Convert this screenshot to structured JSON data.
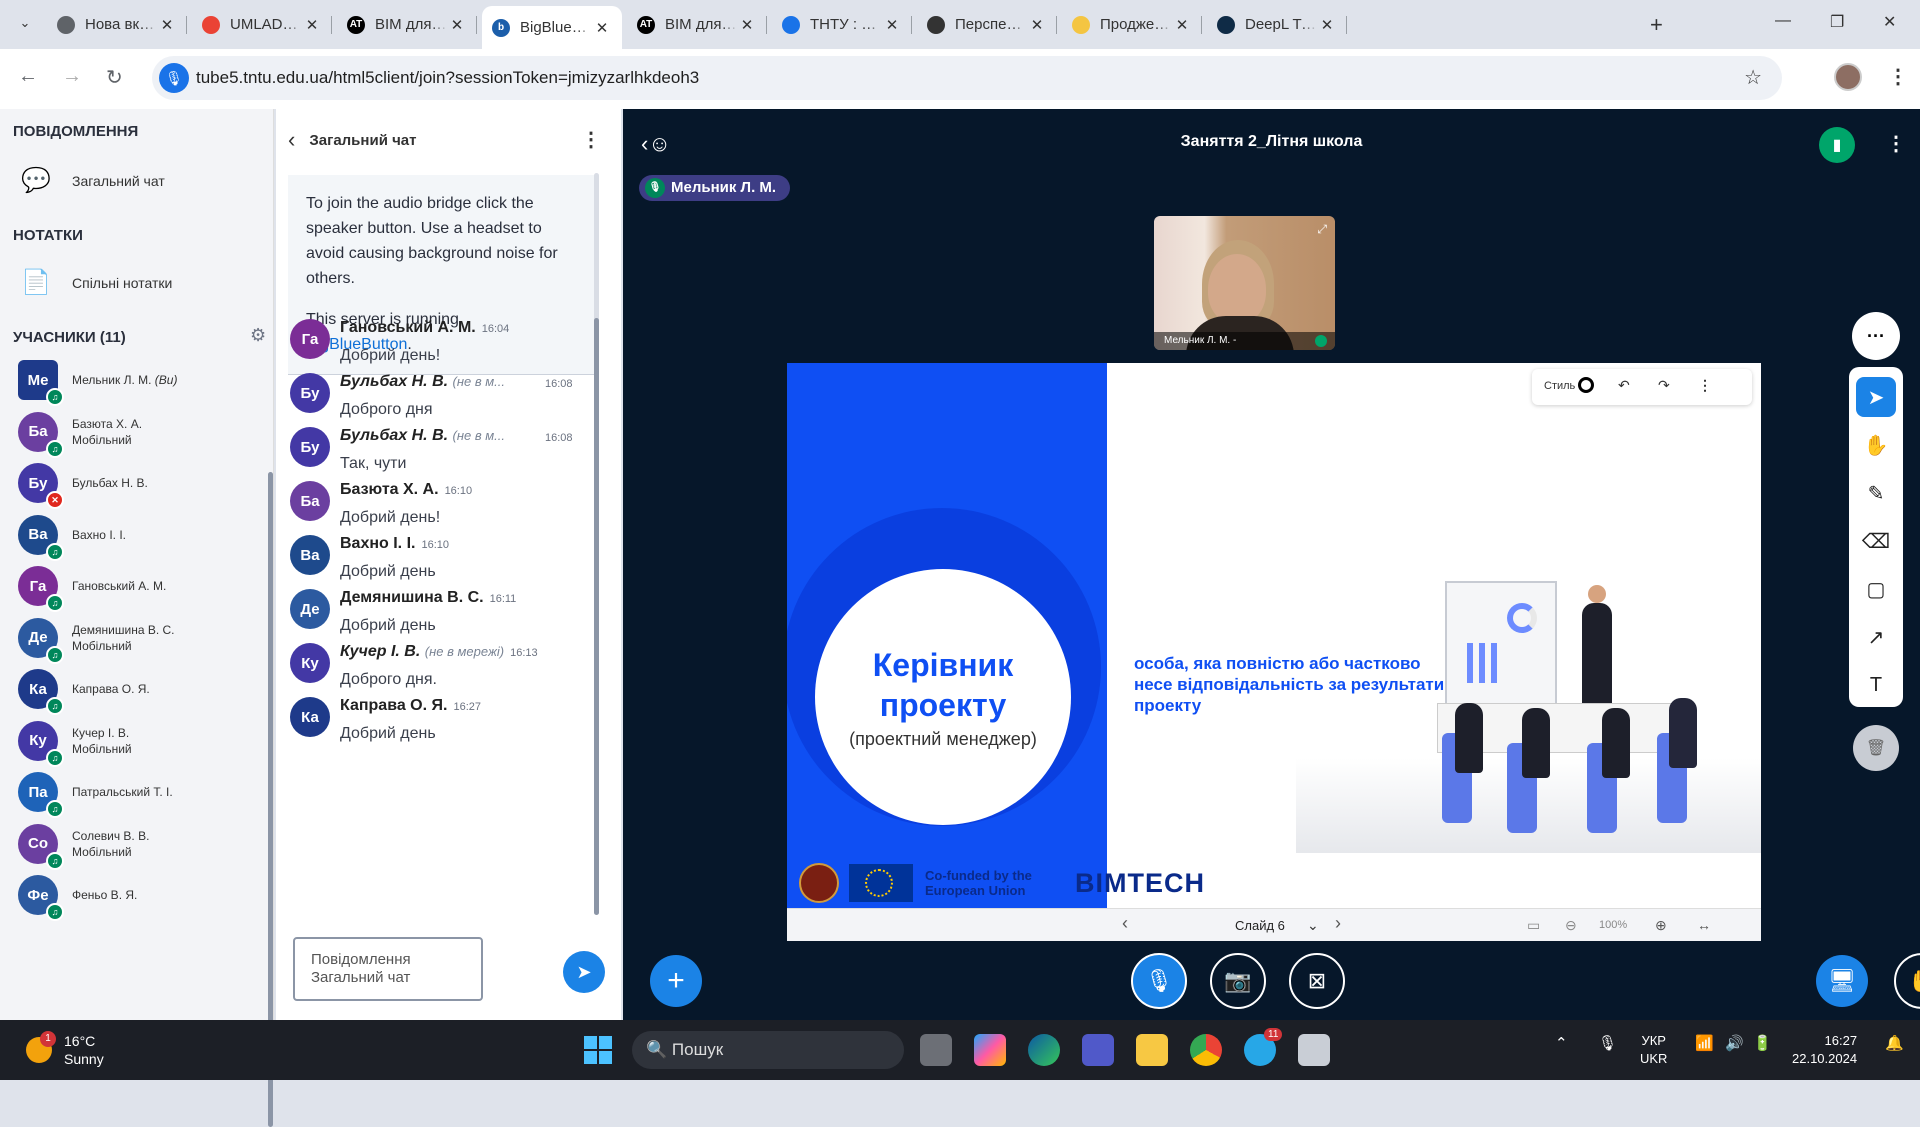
{
  "browser": {
    "tabs": [
      {
        "title": "Нова вкладка",
        "fav": "chrome",
        "color": "#5f6368"
      },
      {
        "title": "UMLADUNG",
        "fav": "gmail",
        "color": "#ea4335"
      },
      {
        "title": "BIM для реконструкції",
        "fav": "AT",
        "color": "#000000"
      },
      {
        "title": "BigBlueButton",
        "fav": "b",
        "color": "#1b5eaa",
        "active": true
      },
      {
        "title": "BIM для реконструкції",
        "fav": "AT",
        "color": "#000000"
      },
      {
        "title": "ТНТУ : Розклад",
        "fav": "tntu",
        "color": "#1a73e8"
      },
      {
        "title": "Перспективи",
        "fav": "gpt",
        "color": "#333333"
      },
      {
        "title": "Проджект менеджмент",
        "fav": "python",
        "color": "#f4c542"
      },
      {
        "title": "DeepL Translate",
        "fav": "deepl",
        "color": "#0f2b46"
      }
    ],
    "url": "tube5.tntu.edu.ua/html5client/join?sessionToken=jmizyzarlhkdeoh3"
  },
  "sidebar": {
    "messages_heading": "ПОВІДОМЛЕННЯ",
    "public_chat": "Загальний чат",
    "notes_heading": "НОТАТКИ",
    "shared_notes": "Спільні нотатки",
    "participants_heading": "УЧАСНИКИ (11)",
    "users": [
      {
        "initials": "Ме",
        "name": "Мельник Л. М.",
        "suffix": "(Ви)",
        "sub": "",
        "color": "#1e3a8a",
        "status": "mic",
        "presenter": true
      },
      {
        "initials": "Ба",
        "name": "Базюта Х. А.",
        "sub": "Мобільний",
        "color": "#6b3fa0",
        "status": "listen"
      },
      {
        "initials": "Бу",
        "name": "Бульбах Н. В.",
        "sub": "",
        "color": "#4338a5",
        "status": "muted"
      },
      {
        "initials": "Ва",
        "name": "Вахно І. І.",
        "sub": "",
        "color": "#1e4a8c",
        "status": "listen"
      },
      {
        "initials": "Га",
        "name": "Гановський А. М.",
        "sub": "",
        "color": "#7b2d96",
        "status": "listen"
      },
      {
        "initials": "Де",
        "name": "Демянишина В. С.",
        "sub": "Мобільний",
        "color": "#2c5aa0",
        "status": "listen"
      },
      {
        "initials": "Ка",
        "name": "Каправа О. Я.",
        "sub": "",
        "color": "#1e3a8a",
        "status": "listen"
      },
      {
        "initials": "Ку",
        "name": "Кучер І. В.",
        "sub": "Мобільний",
        "color": "#4338a5",
        "status": "listen"
      },
      {
        "initials": "Па",
        "name": "Патральський Т. І.",
        "sub": "",
        "color": "#1e63b8",
        "status": "listen"
      },
      {
        "initials": "Со",
        "name": "Солевич В. В.",
        "sub": "Мобільний",
        "color": "#6b3fa0",
        "status": "listen"
      },
      {
        "initials": "Фе",
        "name": "Феньо В. Я.",
        "sub": "",
        "color": "#2c5aa0",
        "status": "listen"
      }
    ]
  },
  "chat": {
    "title": "Загальний чат",
    "welcome1": "To join the audio bridge click the speaker button. Use a headset to avoid causing background noise for others.",
    "welcome2": "This server is running",
    "welcome_link": "BigBlueButton",
    "messages": [
      {
        "initials": "Га",
        "name": "Гановський А. М.",
        "time": "16:04",
        "text": "Добрий день!",
        "offline": false,
        "color": "#7b2d96"
      },
      {
        "initials": "Бу",
        "name": "Бульбах Н. В.",
        "time": "16:08",
        "text": "Доброго дня",
        "offline": true,
        "color": "#4338a5"
      },
      {
        "initials": "Бу",
        "name": "Бульбах Н. В.",
        "time": "16:08",
        "text": "Так, чути",
        "offline": true,
        "color": "#4338a5"
      },
      {
        "initials": "Ба",
        "name": "Базюта Х. А.",
        "time": "16:10",
        "text": "Добрий день!",
        "offline": false,
        "color": "#6b3fa0"
      },
      {
        "initials": "Ва",
        "name": "Вахно І. І.",
        "time": "16:10",
        "text": "Добрий день",
        "offline": false,
        "color": "#1e4a8c"
      },
      {
        "initials": "Де",
        "name": "Демянишина В. С.",
        "time": "16:11",
        "text": "Добрий день",
        "offline": false,
        "color": "#2c5aa0"
      },
      {
        "initials": "Ку",
        "name": "Кучер І. В.",
        "time": "16:13",
        "text": "Доброго дня.",
        "offline": true,
        "color": "#4338a5"
      },
      {
        "initials": "Ка",
        "name": "Каправа О. Я.",
        "time": "16:27",
        "text": "Добрий день",
        "offline": false,
        "color": "#1e3a8a"
      }
    ],
    "offline_label_short": "(не в м...",
    "offline_label_full": "(не в мережі)",
    "input_placeholder": "Повідомлення Загальний чат"
  },
  "meeting": {
    "title": "Заняття 2_Літня школа",
    "talking": "Мельник Л. М.",
    "webcam_name": "Мельник Л. М. -",
    "slide": {
      "title_line1": "Керівник",
      "title_line2": "проекту",
      "subtitle": "(проектний менеджер)",
      "description": "особа, яка повністю або частково несе відповідальність за результати проекту",
      "cofunded": "Co-funded by the European Union",
      "brand": "BIMTECH",
      "page_label": "Слайд 6",
      "zoom": "100%",
      "style_label": "Стиль"
    }
  },
  "taskbar": {
    "temp": "16°C",
    "weather": "Sunny",
    "weather_badge": "1",
    "search": "Пошук",
    "telegram_badge": "11",
    "lang1": "УКР",
    "lang2": "UKR",
    "time": "16:27",
    "date": "22.10.2024"
  }
}
